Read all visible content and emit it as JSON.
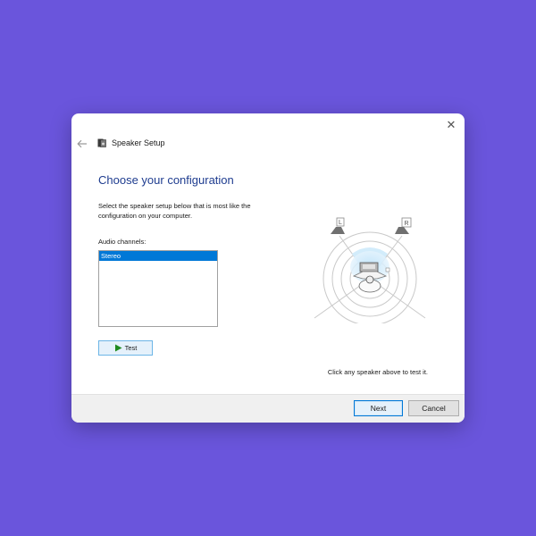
{
  "window": {
    "title": "Speaker Setup",
    "close_label": "✕",
    "back_icon": "arrow-left-icon",
    "app_icon": "speaker-setup-icon"
  },
  "main": {
    "heading": "Choose your configuration",
    "instructions": "Select the speaker setup below that is most like the configuration on your computer.",
    "channels_label": "Audio channels:",
    "channels": [
      {
        "label": "Stereo",
        "selected": true
      }
    ],
    "test_label": "Test",
    "hint": "Click any speaker above to test it."
  },
  "diagram": {
    "left_label": "L",
    "right_label": "R"
  },
  "footer": {
    "next_label": "Next",
    "cancel_label": "Cancel"
  },
  "colors": {
    "background": "#6a55dc",
    "heading": "#1e3c8f",
    "selection": "#0078d7",
    "test_play": "#1f8a1f"
  }
}
